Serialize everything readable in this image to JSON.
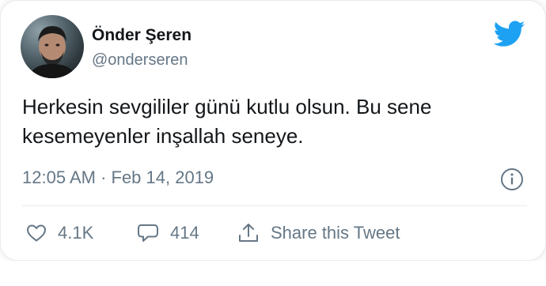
{
  "tweet": {
    "author_name": "Önder Şeren",
    "handle": "@onderseren",
    "text_lines": [
      "Herkesin sevgililer günü kutlu olsun. Bu sene",
      "kesemeyenler inşallah seneye."
    ],
    "timestamp": "12:05 AM · Feb 14, 2019"
  },
  "actions": {
    "likes": "4.1K",
    "replies": "414",
    "share_label": "Share this Tweet"
  },
  "icons": {
    "brand": "twitter-bird-icon",
    "info": "info-icon",
    "like": "heart-icon",
    "reply": "speech-bubble-icon",
    "share": "share-upload-icon"
  },
  "colors": {
    "brand": "#1da1f2",
    "text": "#14171a",
    "secondary": "#657786",
    "divider": "#e6ecf0"
  }
}
